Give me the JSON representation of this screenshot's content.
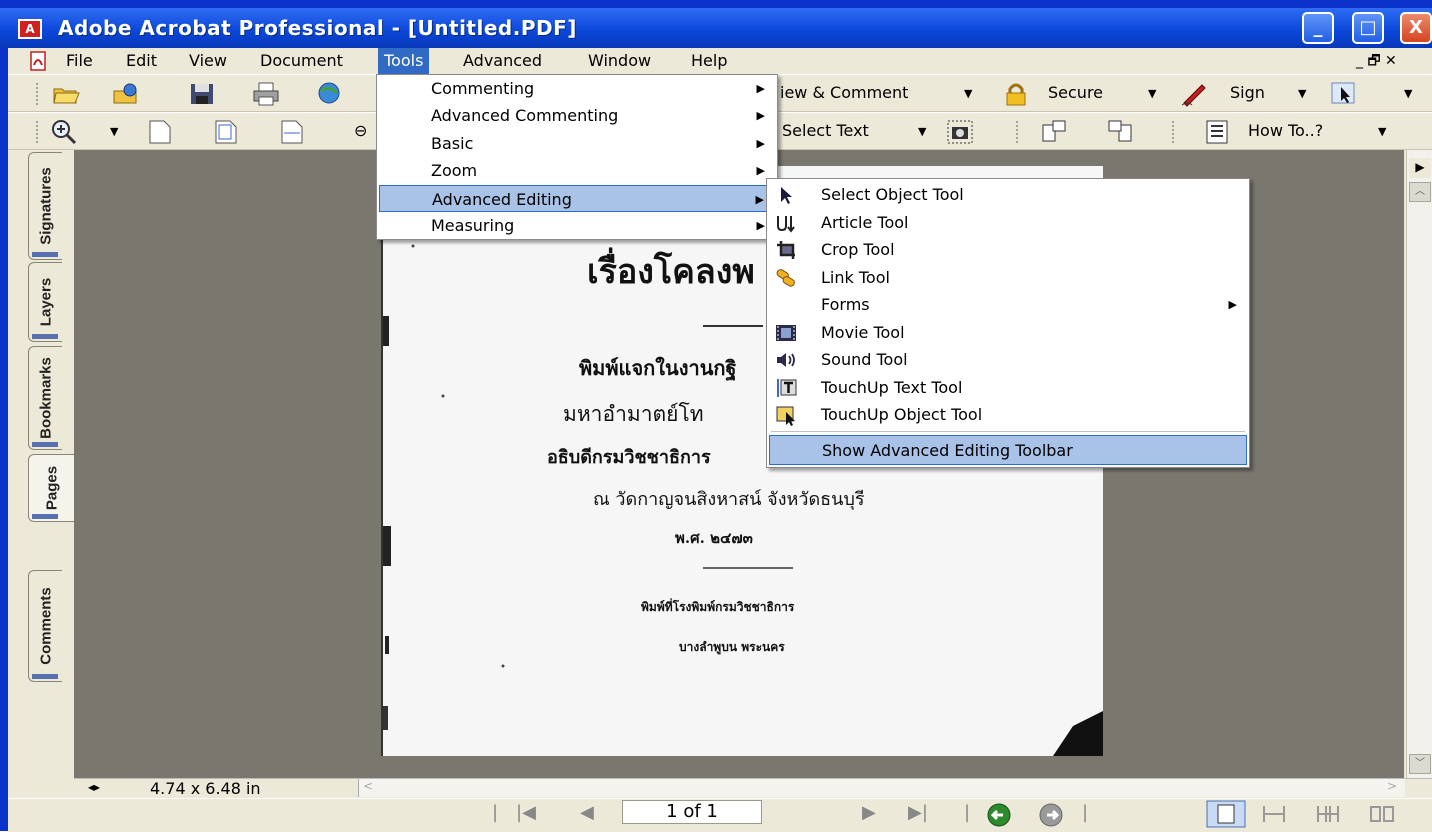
{
  "window": {
    "title": "Adobe Acrobat Professional - [Untitled.PDF]",
    "minimize": "_",
    "maximize": "□",
    "close": "X",
    "app_icon_text": "A"
  },
  "menubar": {
    "items": [
      "File",
      "Edit",
      "View",
      "Document",
      "Tools",
      "Advanced",
      "Window",
      "Help"
    ],
    "active": "Tools",
    "mdi_controls": "_  🗗  ✕"
  },
  "toolbar1": {
    "review_label": "iew & Comment",
    "secure_label": "Secure",
    "sign_label": "Sign"
  },
  "toolbar2": {
    "select_text_label": "Select Text",
    "howto_label": "How To..?"
  },
  "tools_menu": {
    "items": [
      {
        "label": "Commenting",
        "submenu": true
      },
      {
        "label": "Advanced Commenting",
        "submenu": true
      },
      {
        "label": "Basic",
        "submenu": true
      },
      {
        "label": "Zoom",
        "submenu": true
      },
      {
        "label": "Advanced Editing",
        "submenu": true,
        "highlighted": true
      },
      {
        "label": "Measuring",
        "submenu": true
      }
    ]
  },
  "advanced_editing_menu": {
    "items": [
      {
        "label": "Select Object Tool",
        "icon": "arrow-cursor-icon"
      },
      {
        "label": "Article Tool",
        "icon": "article-icon"
      },
      {
        "label": "Crop Tool",
        "icon": "crop-icon"
      },
      {
        "label": "Link Tool",
        "icon": "link-icon"
      },
      {
        "label": "Forms",
        "submenu": true
      },
      {
        "label": "Movie Tool",
        "icon": "film-icon"
      },
      {
        "label": "Sound Tool",
        "icon": "speaker-icon"
      },
      {
        "label": "TouchUp Text Tool",
        "icon": "touchup-text-icon"
      },
      {
        "label": "TouchUp Object Tool",
        "icon": "touchup-object-icon"
      }
    ],
    "footer_item": "Show Advanced Editing Toolbar"
  },
  "side_tabs": [
    "Signatures",
    "Layers",
    "Bookmarks",
    "Pages",
    "Comments"
  ],
  "document": {
    "title_line": "เรื่องโคลงพ",
    "line1": "พิมพ์แจกในงานกฐิ",
    "line2": "มหาอำมาตย์โท",
    "line3": "อธิบดีกรมวิชชาธิการ",
    "line4": "ณ วัดกาญจนสิงหาสน์  จังหวัดธนบุรี",
    "year": "พ.ศ.  ๒๔๗๓",
    "printer": "พิมพ์ที่โรงพิมพ์กรมวิชชาธิการ",
    "place": "บางลำพูบน  พระนคร"
  },
  "page_size": "4.74 x 6.48 in",
  "navigation": {
    "page_field": "1 of 1"
  },
  "colors": {
    "title_blue": "#0a46d8",
    "menu_highlight": "#316ac5",
    "doc_background": "#7a776e",
    "chrome": "#ece9d8"
  }
}
